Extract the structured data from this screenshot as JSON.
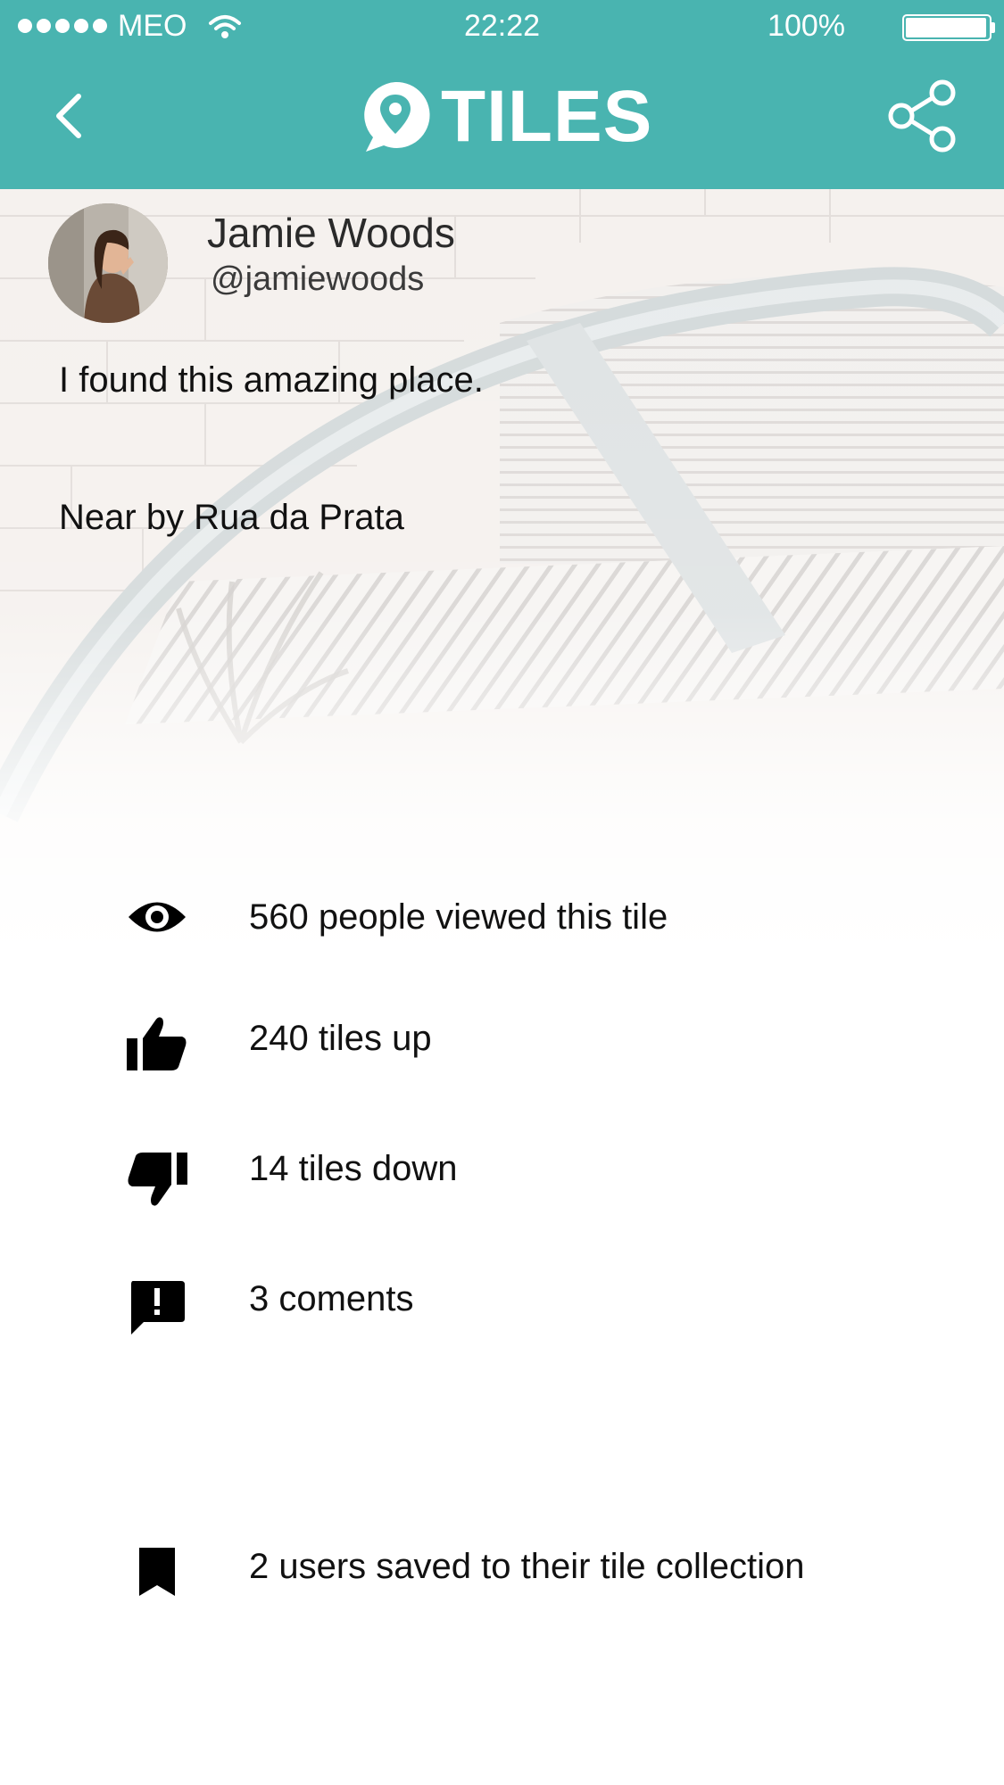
{
  "status_bar": {
    "carrier": "MEO",
    "time": "22:22",
    "battery": "100%"
  },
  "nav": {
    "logo_text": "TILES",
    "back_icon": "chevron-left-icon",
    "share_icon": "share-icon"
  },
  "post": {
    "author_name": "Jamie Woods",
    "author_handle": "@jamiewoods",
    "text": "I found this amazing place.",
    "location": "Near by Rua da Prata"
  },
  "stats": {
    "views": {
      "icon": "eye-icon",
      "text": "560 people viewed this tile"
    },
    "tiles_up": {
      "icon": "thumbs-up-icon",
      "text": "240 tiles up"
    },
    "tiles_down": {
      "icon": "thumbs-down-icon",
      "text": "14 tiles down"
    },
    "comments": {
      "icon": "comment-alert-icon",
      "text": "3 coments"
    },
    "saved": {
      "icon": "bookmark-icon",
      "text": "2 users saved to their tile collection"
    }
  },
  "colors": {
    "accent": "#49b4b0",
    "text": "#111111"
  }
}
